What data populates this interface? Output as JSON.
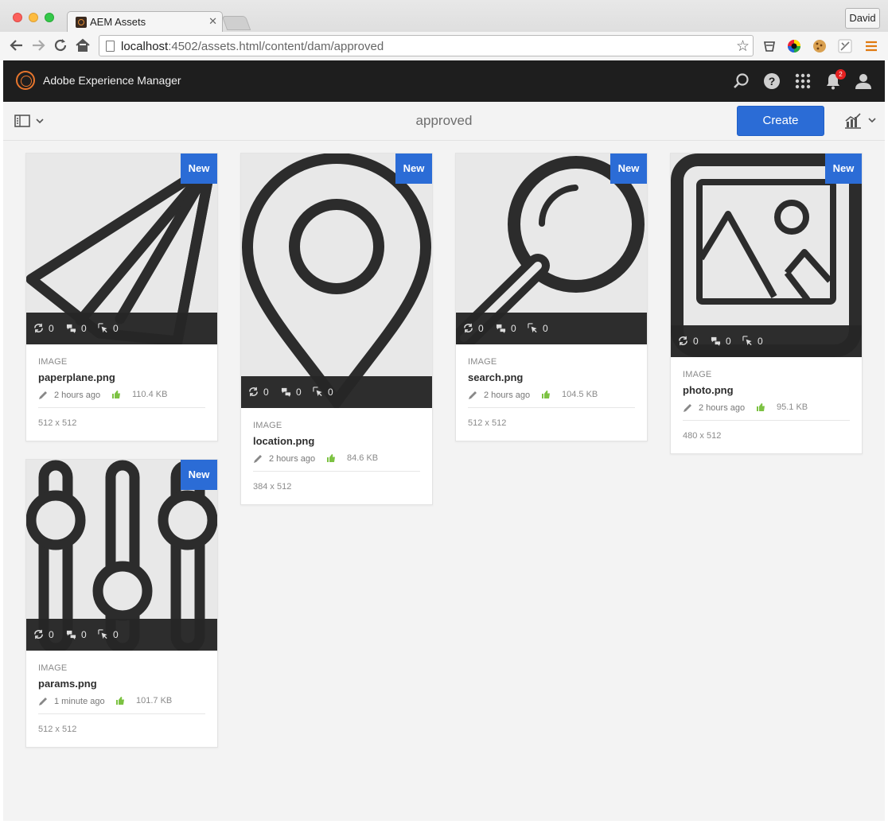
{
  "browser": {
    "tab_title": "AEM Assets",
    "profile": "David",
    "url_host": "localhost",
    "url_path": ":4502/assets.html/content/dam/approved"
  },
  "header": {
    "product": "Adobe Experience Manager",
    "notification_count": "2"
  },
  "actionbar": {
    "title": "approved",
    "create_label": "Create"
  },
  "colors": {
    "accent": "#2b6cd6",
    "header_bg": "#1e1e1e",
    "logo": "#e8762d",
    "approve_green": "#7cc242",
    "badge_red": "#e42020"
  },
  "assets": [
    {
      "badge": "New",
      "type": "IMAGE",
      "name": "paperplane.png",
      "modified": "2 hours ago",
      "size": "110.4 KB",
      "dimensions": "512 x 512",
      "versions": "0",
      "comments": "0",
      "clicks": "0",
      "icon": "paperplane-icon"
    },
    {
      "badge": "New",
      "type": "IMAGE",
      "name": "location.png",
      "modified": "2 hours ago",
      "size": "84.6 KB",
      "dimensions": "384 x 512",
      "versions": "0",
      "comments": "0",
      "clicks": "0",
      "icon": "location-pin-icon"
    },
    {
      "badge": "New",
      "type": "IMAGE",
      "name": "search.png",
      "modified": "2 hours ago",
      "size": "104.5 KB",
      "dimensions": "512 x 512",
      "versions": "0",
      "comments": "0",
      "clicks": "0",
      "icon": "magnifier-icon"
    },
    {
      "badge": "New",
      "type": "IMAGE",
      "name": "photo.png",
      "modified": "2 hours ago",
      "size": "95.1 KB",
      "dimensions": "480 x 512",
      "versions": "0",
      "comments": "0",
      "clicks": "0",
      "icon": "photo-icon"
    },
    {
      "badge": "New",
      "type": "IMAGE",
      "name": "params.png",
      "modified": "1 minute ago",
      "size": "101.7 KB",
      "dimensions": "512 x 512",
      "versions": "0",
      "comments": "0",
      "clicks": "0",
      "icon": "sliders-icon"
    }
  ]
}
